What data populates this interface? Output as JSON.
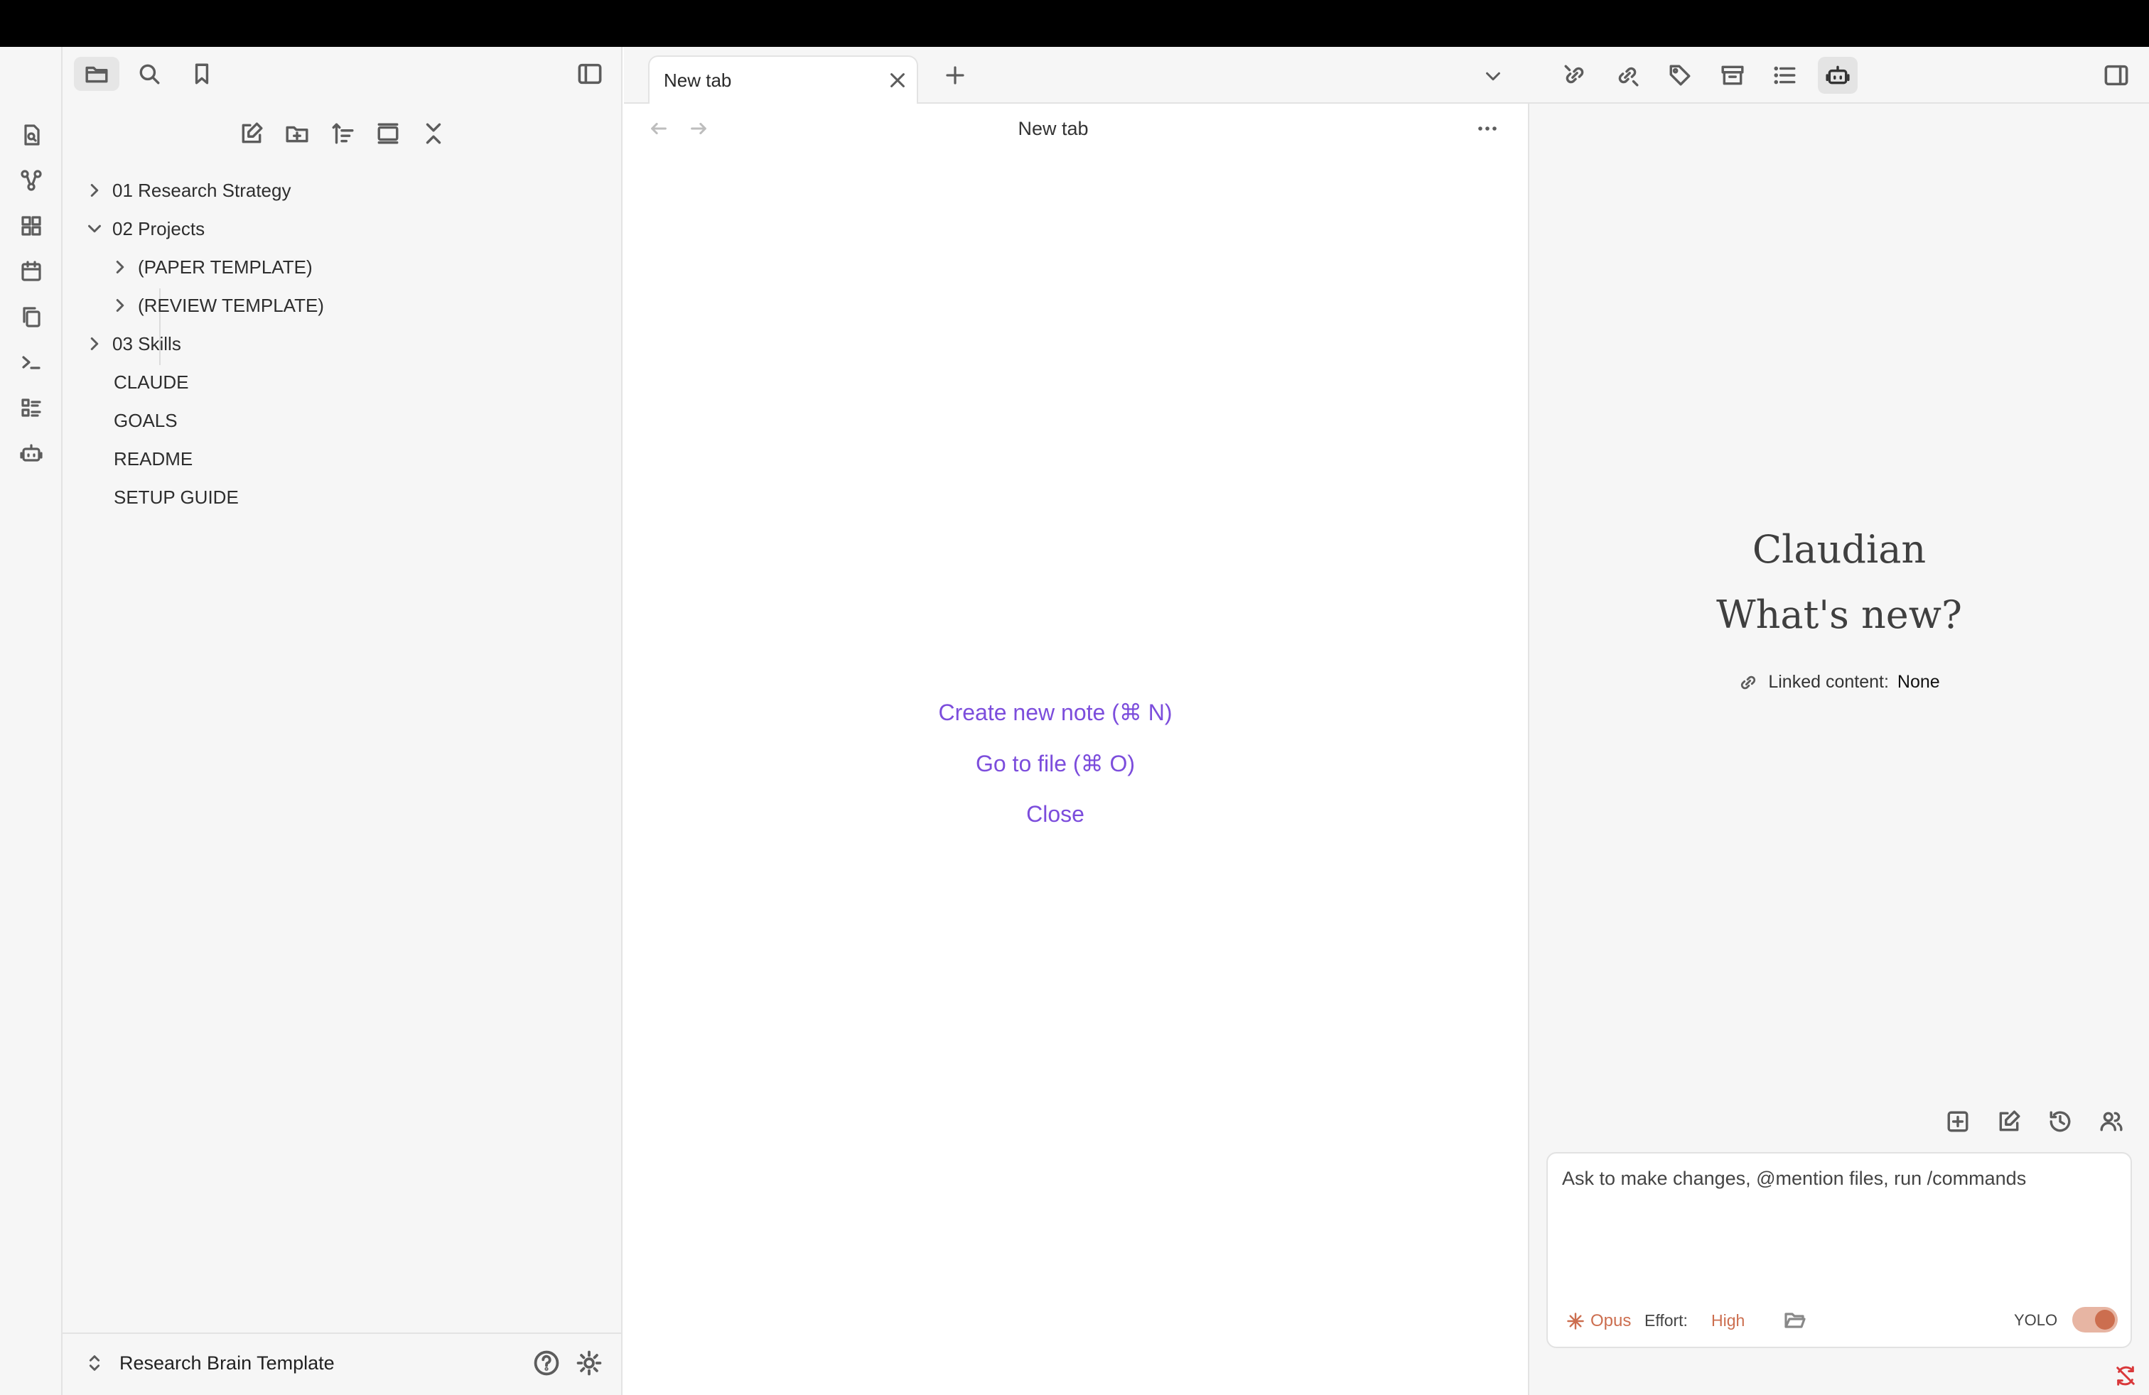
{
  "sidebar": {
    "header_icons": [
      "folder-icon",
      "search-icon",
      "bookmark-icon",
      "sidebar-toggle-icon"
    ],
    "toolbar_icons": [
      "new-note-icon",
      "new-folder-icon",
      "sort-icon",
      "expand-icon",
      "collapse-icon"
    ],
    "tree": [
      {
        "label": "01 Research Strategy",
        "type": "folder",
        "expanded": false
      },
      {
        "label": "02 Projects",
        "type": "folder",
        "expanded": true
      },
      {
        "label": "(PAPER TEMPLATE)",
        "type": "folder",
        "expanded": false
      },
      {
        "label": "(REVIEW TEMPLATE)",
        "type": "folder",
        "expanded": false
      },
      {
        "label": "03 Skills",
        "type": "folder",
        "expanded": false
      },
      {
        "label": "CLAUDE",
        "type": "file"
      },
      {
        "label": "GOALS",
        "type": "file"
      },
      {
        "label": "README",
        "type": "file"
      },
      {
        "label": "SETUP GUIDE",
        "type": "file"
      }
    ],
    "vault_name": "Research Brain Template"
  },
  "ribbon_icons": [
    "file-search-icon",
    "graph-icon",
    "grid-icon",
    "calendar-icon",
    "copy-icon",
    "terminal-icon",
    "list-icon",
    "bot-icon"
  ],
  "tabs": [
    {
      "label": "New tab",
      "active": true
    }
  ],
  "center": {
    "title": "New tab",
    "actions": {
      "create": "Create new note (⌘ N)",
      "goto": "Go to file (⌘ O)",
      "close": "Close"
    }
  },
  "right": {
    "toolbar_icons": [
      "backlinks-icon",
      "outgoing-links-icon",
      "tags-icon",
      "archive-icon",
      "outline-icon",
      "bot-icon"
    ],
    "title": "Claudian",
    "subtitle": "What's new?",
    "linked_label": "Linked content:",
    "linked_value": "None",
    "input_placeholder": "Ask to make changes, @mention files, run /commands",
    "model": "Opus",
    "effort_label": "Effort:",
    "effort_value": "High",
    "yolo_label": "YOLO",
    "yolo_on": true
  },
  "colors": {
    "accent": "#7c4ddc",
    "claude_orange": "#cc6e4f",
    "sidebar_bg": "#f6f6f6"
  }
}
